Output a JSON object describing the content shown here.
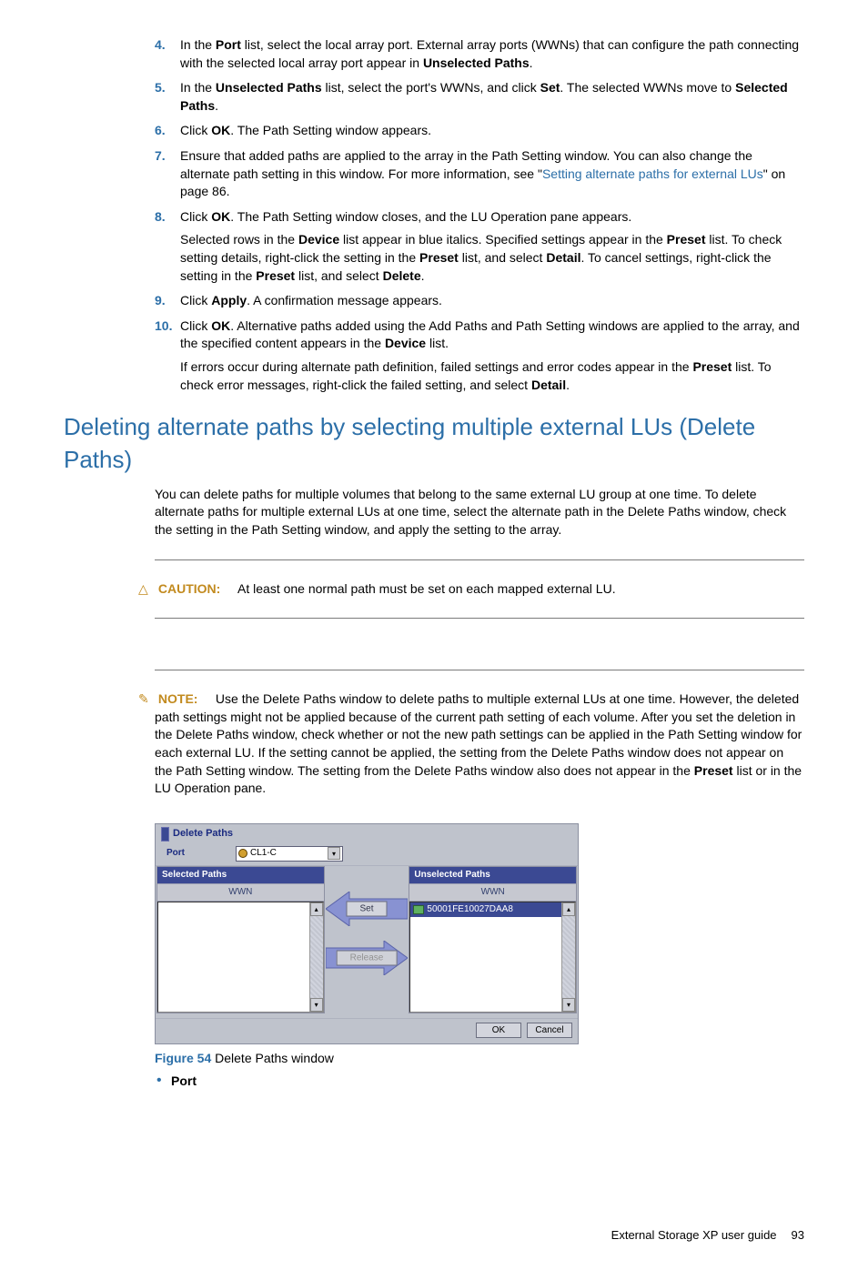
{
  "steps": {
    "4": {
      "pre": "In the ",
      "b1": "Port",
      "mid": " list, select the local array port. External array ports (WWNs) that can configure the path connecting with the selected local array port appear in ",
      "b2": "Unselected Paths",
      "post": "."
    },
    "5": {
      "pre": "In the ",
      "b1": "Unselected Paths",
      "mid": " list, select the port's WWNs, and click ",
      "b2": "Set",
      "post": ". The selected WWNs move to ",
      "b3": "Selected Paths",
      "post2": "."
    },
    "6": {
      "pre": "Click ",
      "b1": "OK",
      "post": ". The Path Setting window appears."
    },
    "7": {
      "text": "Ensure that added paths are applied to the array in the Path Setting window. You can also change the alternate path setting in this window. For more information, see \"",
      "link": "Setting alternate paths for external LUs",
      "text2": "\" on page 86."
    },
    "8": {
      "line1_pre": "Click ",
      "line1_b": "OK",
      "line1_post": ". The Path Setting window closes, and the LU Operation pane appears.",
      "p2_a": "Selected rows in the ",
      "p2_b1": "Device",
      "p2_b": " list appear in blue italics. Specified settings appear in the ",
      "p2_b2": "Preset",
      "p2_c": " list. To check setting details, right-click the setting in the ",
      "p2_b3": "Preset",
      "p2_d": " list, and select ",
      "p2_b4": "Detail",
      "p2_e": ". To cancel settings, right-click the setting in the ",
      "p2_b5": "Preset",
      "p2_f": " list, and select ",
      "p2_b6": "Delete",
      "p2_g": "."
    },
    "9": {
      "pre": "Click ",
      "b1": "Apply",
      "post": ". A confirmation message appears."
    },
    "10": {
      "line1_pre": "Click ",
      "line1_b": "OK",
      "line1_post": ". Alternative paths added using the Add Paths and Path Setting windows are applied to the array, and the specified content appears in the ",
      "line1_b2": "Device",
      "line1_post2": " list.",
      "p2_a": "If errors occur during alternate path definition, failed settings and error codes appear in the ",
      "p2_b1": "Preset",
      "p2_b": " list. To check error messages, right-click the failed setting, and select ",
      "p2_b2": "Detail",
      "p2_c": "."
    }
  },
  "section_title": "Deleting alternate paths by selecting multiple external LUs (Delete Paths)",
  "intro": "You can delete paths for multiple volumes that belong to the same external LU group at one time. To delete alternate paths for multiple external LUs at one time, select the alternate path in the Delete Paths window, check the setting in the Path Setting window, and apply the setting to the array.",
  "caution": {
    "label": "CAUTION:",
    "text": "At least one normal path must be set on each mapped external LU."
  },
  "note": {
    "label": "NOTE:",
    "text_a": "Use the Delete Paths window to delete paths to multiple external LUs at one time. However, the deleted path settings might not be applied because of the current path setting of each volume. After you set the deletion in the Delete Paths window, check whether or not the new path settings can be applied in the Path Setting window for each external LU. If the setting cannot be applied, the setting from the Delete Paths window does not appear on the Path Setting window. The setting from the Delete Paths window also does not appear in the ",
    "b1": "Preset",
    "text_b": " list or in the LU Operation pane."
  },
  "delete_paths_window": {
    "title": "Delete Paths",
    "port_label": "Port",
    "port_value": "CL1-C",
    "selected_title": "Selected Paths",
    "unselected_title": "Unselected Paths",
    "col_header": "WWN",
    "unselected_row": "50001FE10027DAA8",
    "set_btn": "Set",
    "release_btn": "Release",
    "ok_btn": "OK",
    "cancel_btn": "Cancel"
  },
  "figure": {
    "label": "Figure 54",
    "caption": " Delete Paths window"
  },
  "bullet1": "Port",
  "footer": {
    "doc": "External Storage XP user guide",
    "page": "93"
  }
}
